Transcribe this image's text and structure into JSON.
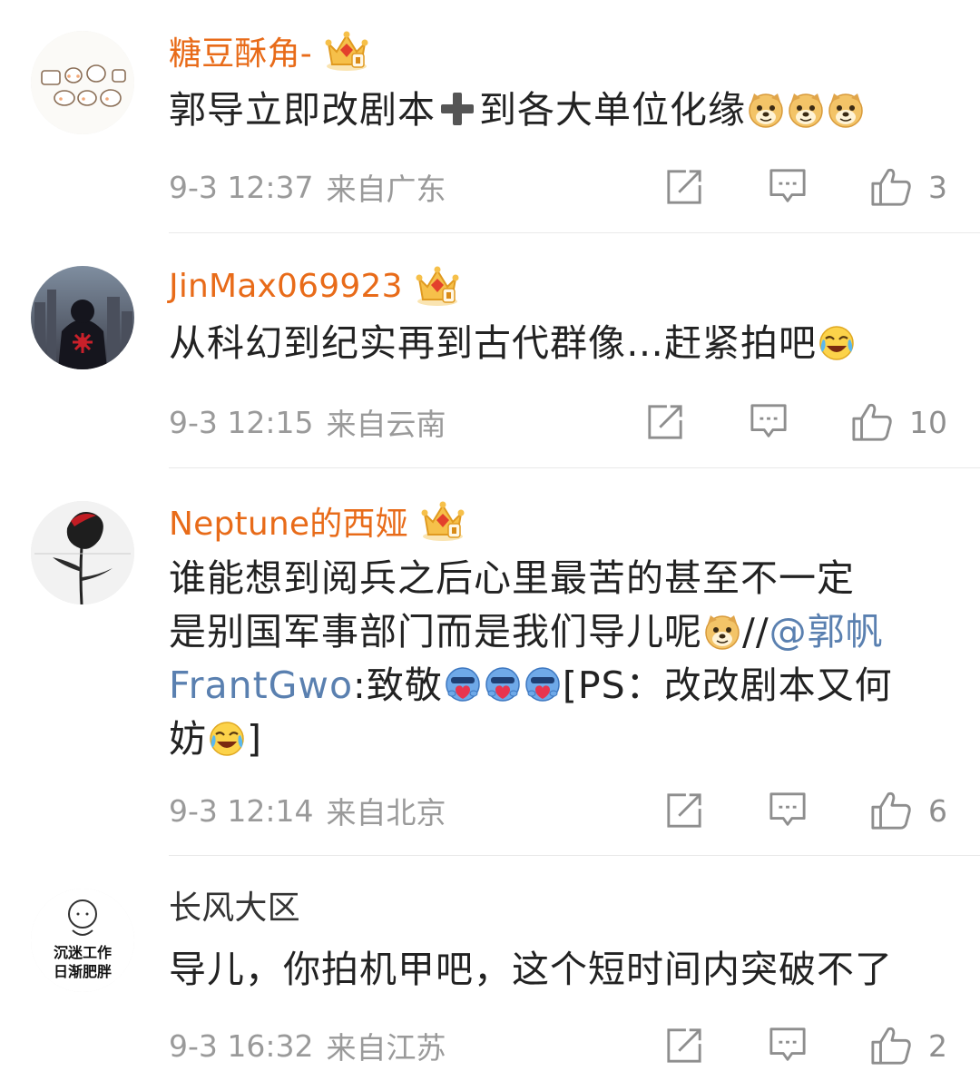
{
  "comments": [
    {
      "username": "糖豆酥角-",
      "text_before": "郭导立即改剧本",
      "text_after": "到各大单位化缘",
      "time": "9-3 12:37",
      "location": "来自广东",
      "likes": "3"
    },
    {
      "username": "JinMax069923",
      "text": "从科幻到纪实再到古代群像…赶紧拍吧",
      "time": "9-3 12:15",
      "location": "来自云南",
      "likes": "10"
    },
    {
      "username": "Neptune的西娅",
      "line1": "谁能想到阅兵之后心里最苦的甚至不一定",
      "line2": "是别国军事部门而是我们导儿呢",
      "slashes": "//",
      "mention_a": "@郭帆",
      "mention_b": "FrantGwo",
      "after_mention": ":致敬",
      "ps": "[PS：改改剧本又何",
      "line4": "妨",
      "close": "]",
      "time": "9-3 12:14",
      "location": "来自北京",
      "likes": "6"
    },
    {
      "username": "长风大区",
      "text": "导儿，你拍机甲吧，这个短时间内突破不了",
      "avatar_text_1": "沉迷工作",
      "avatar_text_2": "日渐肥胖",
      "time": "9-3 16:32",
      "location": "来自江苏",
      "likes": "2"
    }
  ],
  "icons": {
    "badge": "crown-badge-icon",
    "repost": "repost-icon",
    "comment": "comment-icon",
    "like": "thumbs-up-icon"
  },
  "colors": {
    "username": "#e86b19",
    "mention": "#5a80b0",
    "meta": "#9a9a9a"
  }
}
